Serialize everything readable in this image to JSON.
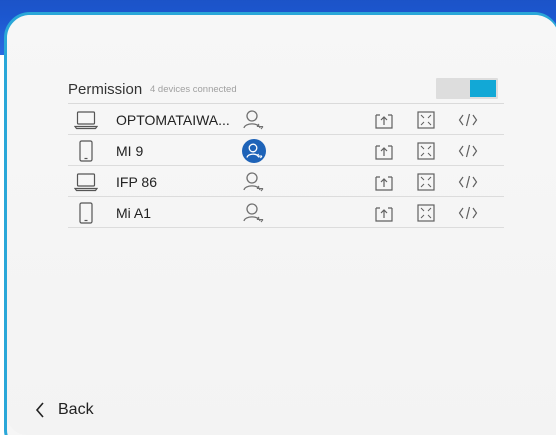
{
  "header": {
    "title": "Permission",
    "subtitle": "4 devices connected",
    "toggle_state": "on"
  },
  "devices": [
    {
      "name": "OPTOMATAIWA...",
      "type": "laptop",
      "permission_active": false
    },
    {
      "name": "MI 9",
      "type": "phone",
      "permission_active": true
    },
    {
      "name": "IFP 86",
      "type": "laptop",
      "permission_active": false
    },
    {
      "name": "Mi A1",
      "type": "phone",
      "permission_active": false
    }
  ],
  "actions": [
    "share-screen-icon",
    "fullscreen-icon",
    "code-icon"
  ],
  "footer": {
    "back_label": "Back"
  },
  "colors": {
    "accent": "#12a8d6",
    "header_bar": "#1c57cf",
    "active_permission": "#1e63b8",
    "icon_gray": "#707070"
  }
}
